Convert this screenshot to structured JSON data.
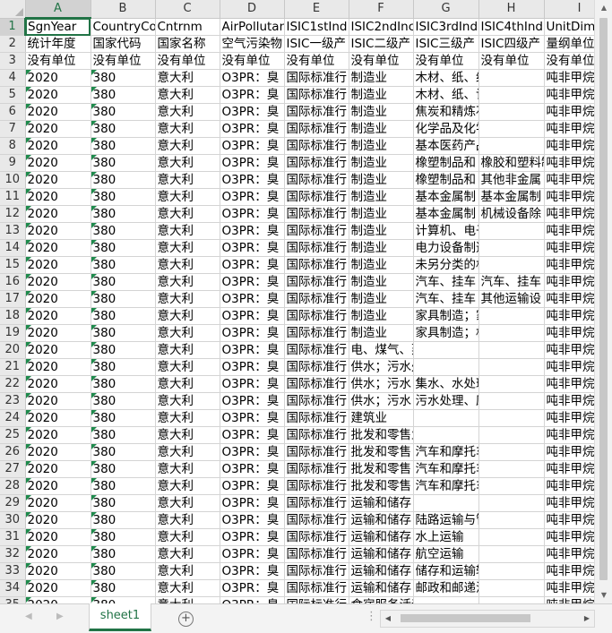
{
  "columns": [
    "A",
    "B",
    "C",
    "D",
    "E",
    "F",
    "G",
    "H",
    "I"
  ],
  "rows": [
    [
      "SgnYear",
      "CountryCo",
      "Cntrnm",
      "AirPollutan",
      "ISIC1stInd",
      "ISIC2ndInc",
      "ISIC3rdInd",
      "ISIC4thInd",
      "UnitDime"
    ],
    [
      "统计年度",
      "国家代码",
      "国家名称",
      "空气污染物",
      "ISIC一级产",
      "ISIC二级产",
      "ISIC三级产",
      "ISIC四级产",
      "量纲单位"
    ],
    [
      "没有单位",
      "没有单位",
      "没有单位",
      "没有单位",
      "没有单位",
      "没有单位",
      "没有单位",
      "没有单位",
      "没有单位"
    ],
    [
      "2020",
      "380",
      "意大利",
      "O3PR：臭",
      "国际标准行",
      "制造业",
      "木材、纸、纸和纸制品",
      "",
      "吨非甲烷"
    ],
    [
      "2020",
      "380",
      "意大利",
      "O3PR：臭",
      "国际标准行",
      "制造业",
      "木材、纸、记录媒介复制",
      "",
      "吨非甲烷"
    ],
    [
      "2020",
      "380",
      "意大利",
      "O3PR：臭",
      "国际标准行",
      "制造业",
      "焦炭和精炼石油产品制造",
      "",
      "吨非甲烷"
    ],
    [
      "2020",
      "380",
      "意大利",
      "O3PR：臭",
      "国际标准行",
      "制造业",
      "化学品及化学制品制造",
      "",
      "吨非甲烷"
    ],
    [
      "2020",
      "380",
      "意大利",
      "O3PR：臭",
      "国际标准行",
      "制造业",
      "基本医药产品和医药制剂",
      "",
      "吨非甲烷"
    ],
    [
      "2020",
      "380",
      "意大利",
      "O3PR：臭",
      "国际标准行",
      "制造业",
      "橡塑制品和",
      "橡胶和塑料制品",
      "吨非甲烷"
    ],
    [
      "2020",
      "380",
      "意大利",
      "O3PR：臭",
      "国际标准行",
      "制造业",
      "橡塑制品和",
      "其他非金属",
      "吨非甲烷"
    ],
    [
      "2020",
      "380",
      "意大利",
      "O3PR：臭",
      "国际标准行",
      "制造业",
      "基本金属制",
      "基本金属制",
      "吨非甲烷"
    ],
    [
      "2020",
      "380",
      "意大利",
      "O3PR：臭",
      "国际标准行",
      "制造业",
      "基本金属制",
      "机械设备除",
      "吨非甲烷"
    ],
    [
      "2020",
      "380",
      "意大利",
      "O3PR：臭",
      "国际标准行",
      "制造业",
      "计算机、电子产品和光学",
      "",
      "吨非甲烷"
    ],
    [
      "2020",
      "380",
      "意大利",
      "O3PR：臭",
      "国际标准行",
      "制造业",
      "电力设备制造",
      "",
      "吨非甲烷"
    ],
    [
      "2020",
      "380",
      "意大利",
      "O3PR：臭",
      "国际标准行",
      "制造业",
      "未另分类的机械和设备",
      "",
      "吨非甲烷"
    ],
    [
      "2020",
      "380",
      "意大利",
      "O3PR：臭",
      "国际标准行",
      "制造业",
      "汽车、挂车",
      "汽车、挂车",
      "吨非甲烷"
    ],
    [
      "2020",
      "380",
      "意大利",
      "O3PR：臭",
      "国际标准行",
      "制造业",
      "汽车、挂车",
      "其他运输设",
      "吨非甲烷"
    ],
    [
      "2020",
      "380",
      "意大利",
      "O3PR：臭",
      "国际标准行",
      "制造业",
      "家具制造；家具制造；其",
      "",
      "吨非甲烷"
    ],
    [
      "2020",
      "380",
      "意大利",
      "O3PR：臭",
      "国际标准行",
      "制造业",
      "家具制造；机械和设备",
      "",
      "吨非甲烷"
    ],
    [
      "2020",
      "380",
      "意大利",
      "O3PR：臭",
      "国际标准行",
      "电、煤气、蒸气和空调供应",
      "",
      "",
      "吨非甲烷"
    ],
    [
      "2020",
      "380",
      "意大利",
      "O3PR：臭",
      "国际标准行",
      "供水；污水处理、废物管理和补救",
      "",
      "",
      "吨非甲烷"
    ],
    [
      "2020",
      "380",
      "意大利",
      "O3PR：臭",
      "国际标准行",
      "供水；污水",
      "集水、水处理与水供应",
      "",
      "吨非甲烷"
    ],
    [
      "2020",
      "380",
      "意大利",
      "O3PR：臭",
      "国际标准行",
      "供水；污水",
      "污水处理、废物管理和补",
      "",
      "吨非甲烷"
    ],
    [
      "2020",
      "380",
      "意大利",
      "O3PR：臭",
      "国际标准行",
      "建筑业",
      "",
      "",
      "吨非甲烷"
    ],
    [
      "2020",
      "380",
      "意大利",
      "O3PR：臭",
      "国际标准行",
      "批发和零售业；汽车和摩托车修理",
      "",
      "",
      "吨非甲烷"
    ],
    [
      "2020",
      "380",
      "意大利",
      "O3PR：臭",
      "国际标准行",
      "批发和零售",
      "汽车和摩托车的批发、零",
      "",
      "吨非甲烷"
    ],
    [
      "2020",
      "380",
      "意大利",
      "O3PR：臭",
      "国际标准行",
      "批发和零售",
      "汽车和摩托车除外的批发",
      "",
      "吨非甲烷"
    ],
    [
      "2020",
      "380",
      "意大利",
      "O3PR：臭",
      "国际标准行",
      "批发和零售",
      "汽车和摩托车除外的零售",
      "",
      "吨非甲烷"
    ],
    [
      "2020",
      "380",
      "意大利",
      "O3PR：臭",
      "国际标准行",
      "运输和储存",
      "",
      "",
      "吨非甲烷"
    ],
    [
      "2020",
      "380",
      "意大利",
      "O3PR：臭",
      "国际标准行",
      "运输和储存",
      "陆路运输与管道运输",
      "",
      "吨非甲烷"
    ],
    [
      "2020",
      "380",
      "意大利",
      "O3PR：臭",
      "国际标准行",
      "运输和储存",
      "水上运输",
      "",
      "吨非甲烷"
    ],
    [
      "2020",
      "380",
      "意大利",
      "O3PR：臭",
      "国际标准行",
      "运输和储存",
      "航空运输",
      "",
      "吨非甲烷"
    ],
    [
      "2020",
      "380",
      "意大利",
      "O3PR：臭",
      "国际标准行",
      "运输和储存",
      "储存和运输辅助活动",
      "",
      "吨非甲烷"
    ],
    [
      "2020",
      "380",
      "意大利",
      "O3PR：臭",
      "国际标准行",
      "运输和储存",
      "邮政和邮递活动",
      "",
      "吨非甲烷"
    ],
    [
      "2020",
      "380",
      "意大利",
      "O3PR：臭",
      "国际标准行",
      "食宿服务活动",
      "",
      "",
      "吨非甲烷"
    ]
  ],
  "sheet_tab": "sheet1",
  "active_cell": "A1",
  "icons": {
    "first_sheet": "triangle-left-icon",
    "last_sheet": "triangle-right-icon",
    "add_sheet": "plus-circle-icon",
    "scroll_left": "triangle-left-icon",
    "scroll_right": "triangle-right-icon"
  },
  "colors": {
    "accent": "#217346",
    "grid": "#d4d4d4",
    "header_bg": "#e9e9e9"
  }
}
